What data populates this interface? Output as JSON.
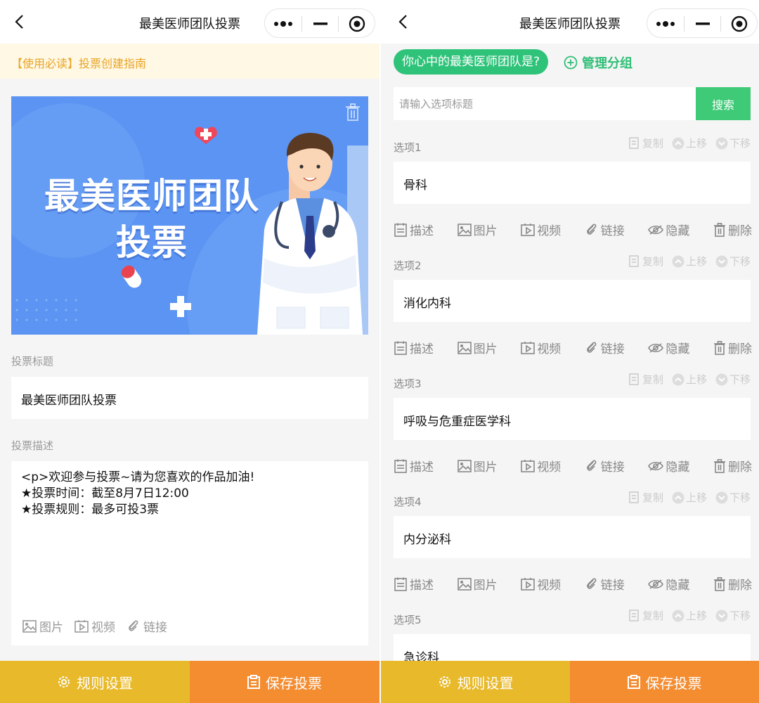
{
  "nav": {
    "title": "最美医师团队投票"
  },
  "guide": {
    "text": "【使用必读】投票创建指南"
  },
  "banner": {
    "line1": "最美医师团队",
    "line2": "投票"
  },
  "form": {
    "title_label": "投票标题",
    "title_value": "最美医师团队投票",
    "desc_label": "投票描述",
    "desc_lines": [
      "<p>欢迎参与投票~请为您喜欢的作品加油!",
      "★投票时间：截至8月7日12:00",
      "★投票规则：最多可投3票"
    ],
    "tools": [
      "图片",
      "视频",
      "链接"
    ]
  },
  "bottom": {
    "rule_label": "规则设置",
    "save_label": "保存投票"
  },
  "right": {
    "question": "你心中的最美医师团队是?",
    "manage_label": "管理分组",
    "search_placeholder": "请输入选项标题",
    "search_button": "搜索",
    "mini_actions": [
      "复制",
      "上移",
      "下移"
    ],
    "option_tools": [
      "描述",
      "图片",
      "视频",
      "链接",
      "隐藏",
      "删除"
    ],
    "options": [
      {
        "label": "选项1",
        "value": "骨科"
      },
      {
        "label": "选项2",
        "value": "消化内科"
      },
      {
        "label": "选项3",
        "value": "呼吸与危重症医学科"
      },
      {
        "label": "选项4",
        "value": "内分泌科"
      },
      {
        "label": "选项5",
        "value": "急诊科"
      }
    ]
  },
  "colors": {
    "green": "#2fc37a",
    "yellow": "#e8b92a",
    "orange": "#f48c30",
    "banner_blue": "#5b94f2"
  }
}
